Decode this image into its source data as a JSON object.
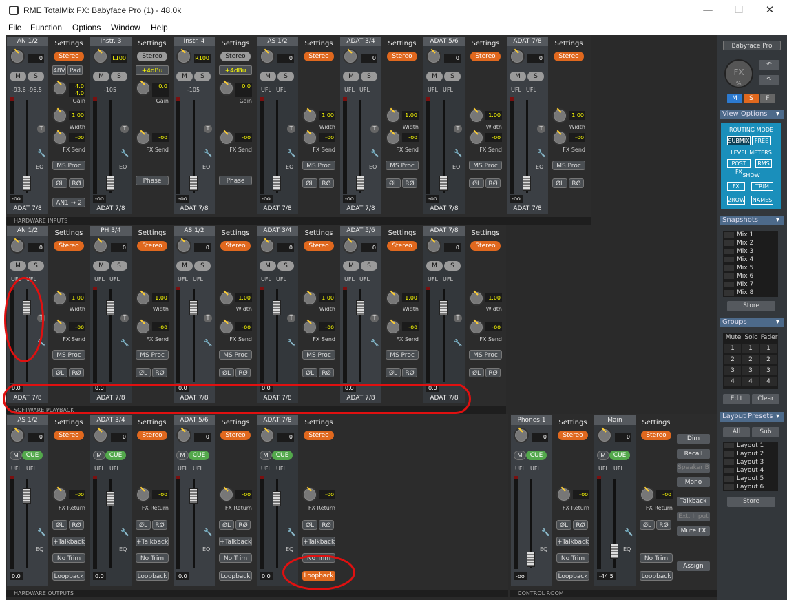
{
  "window": {
    "title": "RME TotalMix FX: Babyface Pro (1) - 48.0k"
  },
  "menu": [
    "File",
    "Function",
    "Options",
    "Window",
    "Help"
  ],
  "inputs": {
    "label": "HARDWARE INPUTS",
    "channels": [
      {
        "name": "AN 1/2",
        "gain": "0",
        "level": "-93.6  -96.5",
        "foot": "ADAT 7/8",
        "stereo": "Stereo",
        "extra": [
          "48V",
          "Pad"
        ],
        "width": "1.00",
        "fxsend": "-oo",
        "gain2": "4.0\n4.0",
        "fader": "-oo",
        "phase": "",
        "route": "AN1 → 2"
      },
      {
        "name": "Instr. 3",
        "gain": "L100",
        "level": "-105",
        "foot": "ADAT 7/8",
        "stereo": "Stereo",
        "opt": "+4dBu",
        "gain2": "0.0",
        "fxsend": "-oo",
        "fader": "-oo",
        "phase": "Phase"
      },
      {
        "name": "Instr. 4",
        "gain": "R100",
        "level": "-105",
        "foot": "ADAT 7/8",
        "stereo": "Stereo",
        "opt": "+4dBu",
        "gain2": "0.0",
        "fxsend": "-oo",
        "fader": "-oo",
        "phase": "Phase"
      },
      {
        "name": "AS 1/2",
        "gain": "0",
        "foot": "ADAT 7/8",
        "stereo": "Stereo",
        "width": "1.00",
        "fxsend": "-oo",
        "fader": "-oo"
      },
      {
        "name": "ADAT 3/4",
        "gain": "0",
        "foot": "ADAT 7/8",
        "stereo": "Stereo",
        "width": "1.00",
        "fxsend": "-oo",
        "fader": "-oo"
      },
      {
        "name": "ADAT 5/6",
        "gain": "0",
        "foot": "ADAT 7/8",
        "stereo": "Stereo",
        "width": "1.00",
        "fxsend": "-oo",
        "fader": "-oo"
      },
      {
        "name": "ADAT 7/8",
        "gain": "0",
        "foot": "ADAT 7/8",
        "stereo": "Stereo",
        "width": "1.00",
        "fxsend": "-oo",
        "fader": "-oo"
      }
    ]
  },
  "playback": {
    "label": "SOFTWARE PLAYBACK",
    "channels": [
      {
        "name": "AN 1/2",
        "gain": "0",
        "foot": "ADAT 7/8",
        "stereo": "Stereo",
        "width": "1.00",
        "fxsend": "-oo",
        "fader": "0.0"
      },
      {
        "name": "PH 3/4",
        "gain": "0",
        "foot": "ADAT 7/8",
        "stereo": "Stereo",
        "width": "1.00",
        "fxsend": "-oo",
        "fader": "0.0"
      },
      {
        "name": "AS 1/2",
        "gain": "0",
        "foot": "ADAT 7/8",
        "stereo": "Stereo",
        "width": "1.00",
        "fxsend": "-oo",
        "fader": "0.0"
      },
      {
        "name": "ADAT 3/4",
        "gain": "0",
        "foot": "ADAT 7/8",
        "stereo": "Stereo",
        "width": "1.00",
        "fxsend": "-oo",
        "fader": "0.0"
      },
      {
        "name": "ADAT 5/6",
        "gain": "0",
        "foot": "ADAT 7/8",
        "stereo": "Stereo",
        "width": "1.00",
        "fxsend": "-oo",
        "fader": "0.0"
      },
      {
        "name": "ADAT 7/8",
        "gain": "0",
        "foot": "ADAT 7/8",
        "stereo": "Stereo",
        "width": "1.00",
        "fxsend": "-oo",
        "fader": "0.0"
      }
    ]
  },
  "outputs": {
    "label": "HARDWARE OUTPUTS",
    "channels": [
      {
        "name": "AS 1/2",
        "gain": "0",
        "stereo": "Stereo",
        "fxret": "-oo",
        "fader": "0.0",
        "loopback": "Loopback",
        "notrim": "No Trim",
        "talkback": "+Talkback"
      },
      {
        "name": "ADAT 3/4",
        "gain": "0",
        "stereo": "Stereo",
        "fxret": "-oo",
        "fader": "0.0",
        "loopback": "Loopback",
        "notrim": "No Trim",
        "talkback": "+Talkback"
      },
      {
        "name": "ADAT 5/6",
        "gain": "0",
        "stereo": "Stereo",
        "fxret": "-oo",
        "fader": "0.0",
        "loopback": "Loopback",
        "notrim": "No Trim",
        "talkback": "+Talkback"
      },
      {
        "name": "ADAT 7/8",
        "gain": "0",
        "stereo": "Stereo",
        "fxret": "-oo",
        "fader": "0.0",
        "loopback": "Loopback",
        "notrim": "No Trim",
        "talkback": "+Talkback"
      }
    ]
  },
  "control_room": {
    "label": "CONTROL ROOM",
    "channels": [
      {
        "name": "Phones 1",
        "gain": "0",
        "stereo": "Stereo",
        "fxret": "-oo",
        "fader": "-oo",
        "loopback": "Loopback",
        "notrim": "No Trim",
        "talkback": "+Talkback"
      },
      {
        "name": "Main",
        "gain": "0",
        "stereo": "Stereo",
        "fxret": "-oo",
        "fader": "-44.5",
        "loopback": "Loopback",
        "notrim": "No Trim",
        "talkback": ""
      }
    ],
    "buttons": [
      "Dim",
      "Recall",
      "Speaker B",
      "Mono",
      "Talkback",
      "Ext. Input",
      "Mute FX",
      "Assign"
    ]
  },
  "common": {
    "settings": "Settings",
    "m": "M",
    "s": "S",
    "cue": "CUE",
    "ufl": "UFL",
    "width_lbl": "Width",
    "fxsend_lbl": "FX Send",
    "fxret_lbl": "FX Return",
    "msproc": "MS Proc",
    "phase_l": "ØL",
    "phase_r": "RØ",
    "gain_lbl": "Gain",
    "eq": "EQ",
    "t": "T"
  },
  "right": {
    "device": "Babyface Pro",
    "fx_knob": "FX",
    "fx_pct": "%",
    "msf": [
      "M",
      "S",
      "F"
    ],
    "view_options": "View Options",
    "routing_mode": "ROUTING MODE",
    "submix": "SUBMIX",
    "free": "FREE",
    "level_meters": "LEVEL METERS",
    "postfx": "POST FX",
    "rms": "RMS",
    "show": "SHOW",
    "fx": "FX",
    "trim": "TRIM",
    "row2": "2ROW",
    "names": "NAMES",
    "snapshots": "Snapshots",
    "mixes": [
      "Mix 1",
      "Mix 2",
      "Mix 3",
      "Mix 4",
      "Mix 5",
      "Mix 6",
      "Mix 7",
      "Mix 8"
    ],
    "store": "Store",
    "groups": "Groups",
    "group_hdr": [
      "Mute",
      "Solo",
      "Fader"
    ],
    "group_rows": [
      [
        "1",
        "1",
        "1"
      ],
      [
        "2",
        "2",
        "2"
      ],
      [
        "3",
        "3",
        "3"
      ],
      [
        "4",
        "4",
        "4"
      ]
    ],
    "edit": "Edit",
    "clear": "Clear",
    "layout_presets": "Layout Presets",
    "all": "All",
    "sub": "Sub",
    "layouts": [
      "Layout 1",
      "Layout 2",
      "Layout 3",
      "Layout 4",
      "Layout 5",
      "Layout 6"
    ],
    "store2": "Store"
  }
}
